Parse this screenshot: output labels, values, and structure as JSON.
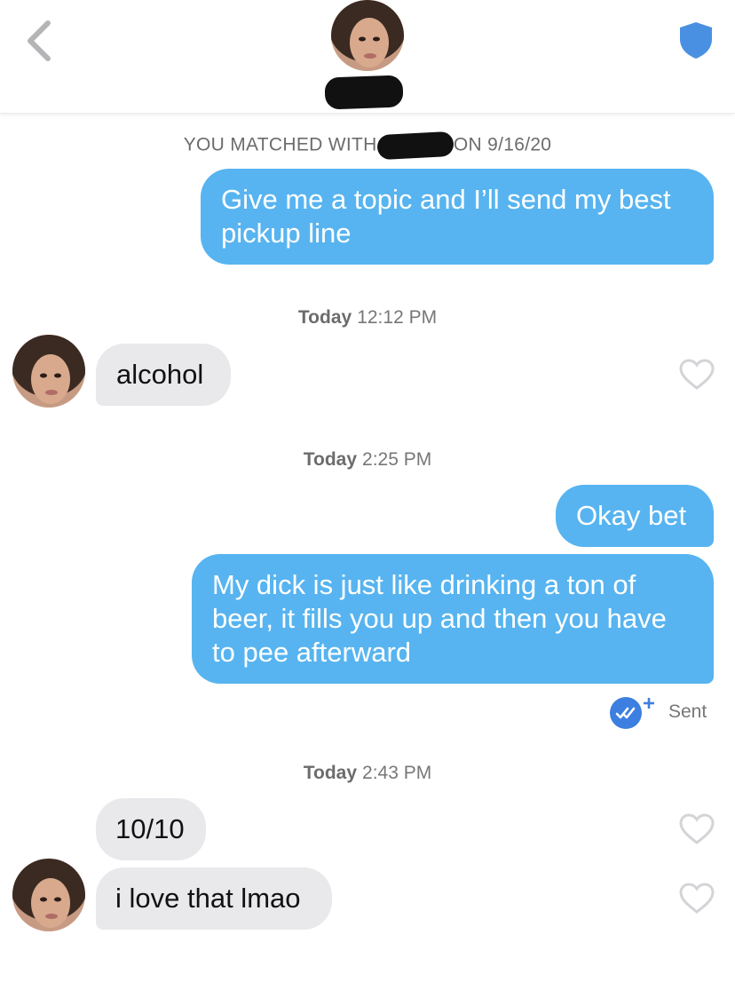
{
  "header": {
    "back_icon": "chevron-left-icon",
    "safety_icon": "shield-icon",
    "accent_color": "#4a90e2"
  },
  "match": {
    "prefix": "YOU MATCHED WITH",
    "suffix": "ON 9/16/20"
  },
  "messages": [
    {
      "id": "m1",
      "direction": "outgoing",
      "text": "Give me a topic and I’ll send my best pickup line"
    },
    {
      "id": "t1",
      "type": "timestamp",
      "day": "Today",
      "time": "12:12 PM"
    },
    {
      "id": "m2",
      "direction": "incoming",
      "text": "alcohol"
    },
    {
      "id": "t2",
      "type": "timestamp",
      "day": "Today",
      "time": "2:25 PM"
    },
    {
      "id": "m3",
      "direction": "outgoing",
      "text": "Okay bet"
    },
    {
      "id": "m4",
      "direction": "outgoing",
      "text": "My dick is just like drinking a ton of beer, it fills you up and then you have to pee afterward"
    },
    {
      "id": "t3",
      "type": "timestamp",
      "day": "Today",
      "time": "2:43 PM"
    },
    {
      "id": "m5",
      "direction": "incoming",
      "text": "10/10"
    },
    {
      "id": "m6",
      "direction": "incoming",
      "text": "i love that lmao"
    }
  ],
  "receipt": {
    "label": "Sent",
    "icon": "double-check-icon"
  },
  "colors": {
    "outgoing_bubble": "#57b4f0",
    "incoming_bubble": "#e9e9ec",
    "read_receipt": "#3d7fe0"
  }
}
